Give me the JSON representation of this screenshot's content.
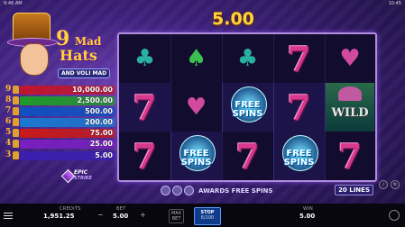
{
  "topbar": {
    "left": "9:46 AM",
    "right": "10:45"
  },
  "logo": {
    "number": "9",
    "word1": "Mad",
    "word2": "Hats",
    "subtitle": "AND VOLI MAD"
  },
  "paytable": [
    {
      "index": "9",
      "value": "10,000.00",
      "color": "#c0162e"
    },
    {
      "index": "8",
      "value": "2,500.00",
      "color": "#1f9a2a"
    },
    {
      "index": "7",
      "value": "500.00",
      "color": "#1050c0"
    },
    {
      "index": "6",
      "value": "200.00",
      "color": "#1a78d0"
    },
    {
      "index": "5",
      "value": "75.00",
      "color": "#c81a1a"
    },
    {
      "index": "4",
      "value": "25.00",
      "color": "#7a1fc0"
    },
    {
      "index": "3",
      "value": "5.00",
      "color": "#3a1fb0"
    }
  ],
  "epic": {
    "line1": "EPIC",
    "line2": "STRIKE"
  },
  "win_amount": "5.00",
  "reels": {
    "fs_line1": "FREE",
    "fs_line2": "SPINS",
    "wild": "WILD",
    "seven": "7",
    "club": "♣",
    "spade": "♠",
    "heart": "♥"
  },
  "awards": "AWARDS FREE SPINS",
  "lines": "20 LINES",
  "bottom": {
    "credits_label": "CREDITS",
    "credits_value": "1,951.25",
    "bet_label": "BET",
    "bet_value": "5.00",
    "minus": "−",
    "plus": "+",
    "maxbet": "MAX\nBET",
    "stop": "STOP",
    "stop_count": "6/100",
    "win_label": "WIN",
    "win_value": "5.00"
  }
}
